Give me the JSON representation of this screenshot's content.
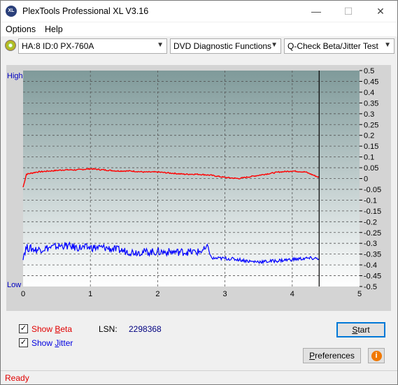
{
  "window": {
    "title": "PlexTools Professional XL V3.16",
    "icon_text": "XL",
    "min": "—",
    "max": "☐",
    "close": "✕"
  },
  "menu": {
    "options": "Options",
    "help": "Help"
  },
  "toolbar": {
    "drive": "HA:8 ID:0  PX-760A",
    "function": "DVD Diagnostic Functions",
    "test": "Q-Check Beta/Jitter Test"
  },
  "chart": {
    "high_label": "High",
    "low_label": "Low",
    "x_ticks": [
      "0",
      "1",
      "2",
      "3",
      "4",
      "5"
    ],
    "y_ticks": [
      "0.5",
      "0.45",
      "0.4",
      "0.35",
      "0.3",
      "0.25",
      "0.2",
      "0.15",
      "0.1",
      "0.05",
      "0",
      "-0.05",
      "-0.1",
      "-0.15",
      "-0.2",
      "-0.25",
      "-0.3",
      "-0.35",
      "-0.4",
      "-0.45",
      "-0.5"
    ]
  },
  "chart_data": {
    "type": "line",
    "xlim": [
      0,
      5
    ],
    "ylim": [
      -0.5,
      0.5
    ],
    "grid": true,
    "end_marker_x": 4.4,
    "colors": {
      "beta": "#ff0000",
      "jitter": "#0000ff",
      "background_top": "#7f9a9a",
      "background_bottom": "#ffffff"
    },
    "series": [
      {
        "x": [
          0.0,
          0.05,
          0.2,
          0.4,
          0.6,
          0.8,
          1.0,
          1.2,
          1.4,
          1.6,
          1.8,
          2.0,
          2.2,
          2.4,
          2.6,
          2.8,
          3.0,
          3.2,
          3.4,
          3.6,
          3.8,
          4.0,
          4.2,
          4.4
        ],
        "values": [
          -0.04,
          0.02,
          0.03,
          0.035,
          0.04,
          0.04,
          0.045,
          0.04,
          0.035,
          0.035,
          0.03,
          0.03,
          0.025,
          0.02,
          0.02,
          0.015,
          0.005,
          0.0,
          0.01,
          0.02,
          0.03,
          0.035,
          0.03,
          0.005
        ]
      },
      {
        "x": [
          0.0,
          0.05,
          0.2,
          0.4,
          0.6,
          0.8,
          1.0,
          1.2,
          1.4,
          1.6,
          1.8,
          2.0,
          2.2,
          2.4,
          2.6,
          2.7,
          2.75,
          2.8,
          3.0,
          3.2,
          3.4,
          3.6,
          3.8,
          4.0,
          4.2,
          4.4
        ],
        "values": [
          -0.36,
          -0.32,
          -0.33,
          -0.32,
          -0.31,
          -0.32,
          -0.32,
          -0.32,
          -0.33,
          -0.34,
          -0.34,
          -0.34,
          -0.34,
          -0.34,
          -0.34,
          -0.33,
          -0.32,
          -0.37,
          -0.37,
          -0.375,
          -0.385,
          -0.385,
          -0.38,
          -0.375,
          -0.37,
          -0.37
        ]
      }
    ]
  },
  "controls": {
    "show_beta_prefix": "Show ",
    "show_beta_key": "B",
    "show_beta_suffix": "eta",
    "show_jitter_prefix": "Show ",
    "show_jitter_key": "J",
    "show_jitter_suffix": "itter",
    "lsn_label": "LSN:",
    "lsn_value": "2298368",
    "start_prefix": "",
    "start_key": "S",
    "start_suffix": "tart",
    "prefs_prefix": "",
    "prefs_key": "P",
    "prefs_suffix": "references",
    "info_icon": "i"
  },
  "status": {
    "text": "Ready"
  }
}
